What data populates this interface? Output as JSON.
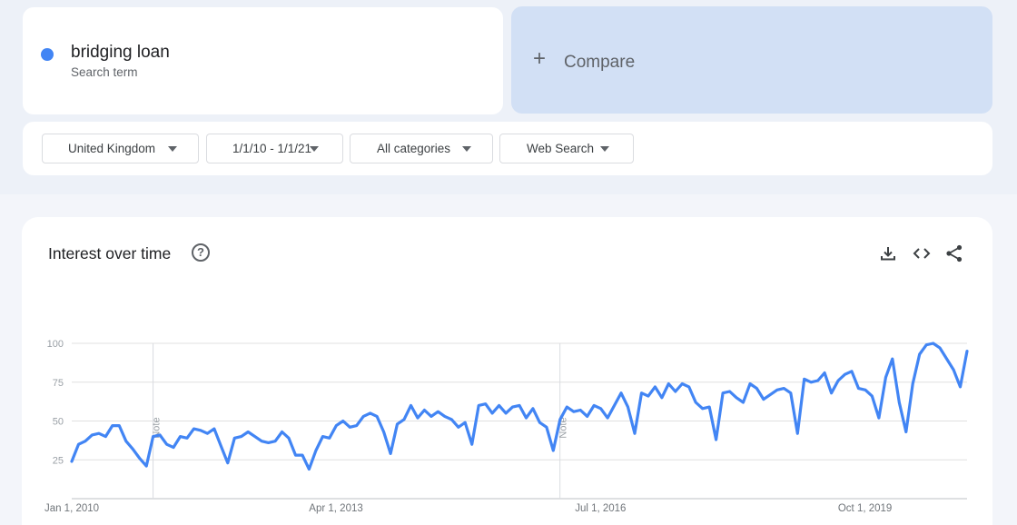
{
  "search_term": {
    "name": "bridging loan",
    "subtitle": "Search term",
    "color": "#4285f4"
  },
  "compare": {
    "label": "Compare",
    "icon": "plus-icon"
  },
  "filters": {
    "region": "United Kingdom",
    "date_range": "1/1/10 - 1/1/21",
    "category": "All categories",
    "search_type": "Web Search"
  },
  "chart_panel": {
    "title": "Interest over time",
    "icons": [
      "help-icon",
      "download-icon",
      "embed-icon",
      "share-icon"
    ]
  },
  "chart_data": {
    "type": "line",
    "title": "Interest over time",
    "ylim": [
      0,
      100
    ],
    "y_ticks": [
      "25",
      "50",
      "75",
      "100"
    ],
    "x_tick_labels": [
      {
        "date": "2010-01-01",
        "label": "Jan 1, 2010"
      },
      {
        "date": "2013-04-01",
        "label": "Apr 1, 2013"
      },
      {
        "date": "2016-07-01",
        "label": "Jul 1, 2016"
      },
      {
        "date": "2019-10-01",
        "label": "Oct 1, 2019"
      }
    ],
    "notes": [
      {
        "date": "2011-01-01",
        "label": "Note"
      },
      {
        "date": "2016-01-01",
        "label": "Note"
      }
    ],
    "x_start": "2010-01-01",
    "x_end": "2021-01-01",
    "series": [
      {
        "color": "#4285f4",
        "values": [
          24,
          35,
          37,
          41,
          42,
          40,
          47,
          47,
          37,
          32,
          26,
          21,
          40,
          41,
          35,
          33,
          40,
          39,
          45,
          44,
          42,
          45,
          34,
          23,
          39,
          40,
          43,
          40,
          37,
          36,
          37,
          43,
          39,
          28,
          28,
          19,
          31,
          40,
          39,
          47,
          50,
          46,
          47,
          53,
          55,
          53,
          43,
          29,
          48,
          51,
          60,
          52,
          57,
          53,
          56,
          53,
          51,
          46,
          49,
          35,
          60,
          61,
          55,
          60,
          55,
          59,
          60,
          52,
          58,
          49,
          46,
          31,
          51,
          59,
          56,
          57,
          53,
          60,
          58,
          52,
          60,
          68,
          59,
          42,
          68,
          66,
          72,
          65,
          74,
          69,
          74,
          72,
          62,
          58,
          59,
          38,
          68,
          69,
          65,
          62,
          74,
          71,
          64,
          67,
          70,
          71,
          68,
          42,
          77,
          75,
          76,
          81,
          68,
          76,
          80,
          82,
          71,
          70,
          66,
          52,
          78,
          90,
          62,
          43,
          74,
          93,
          99,
          100,
          97,
          90,
          83,
          72,
          95
        ]
      }
    ]
  }
}
